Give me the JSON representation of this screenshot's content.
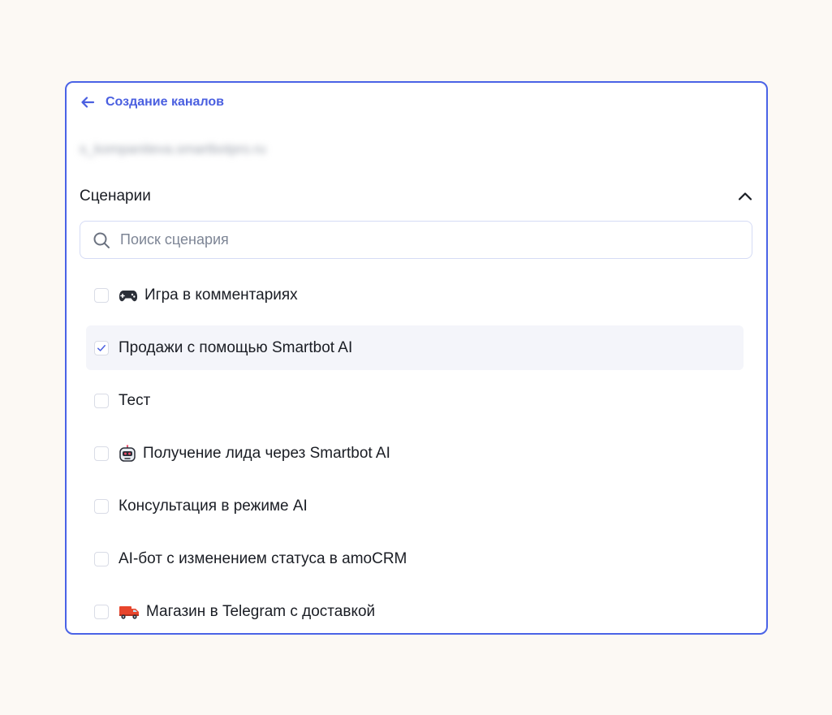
{
  "header": {
    "back_label": "Создание каналов",
    "account_email": "s_kompaniteva.smartbotpro.ru"
  },
  "section": {
    "title": "Сценарии",
    "expanded": true
  },
  "search": {
    "value": "",
    "placeholder": "Поиск сценария"
  },
  "scenarios": [
    {
      "label": "Игра в комментариях",
      "emoji": "🎮",
      "checked": false
    },
    {
      "label": "Продажи с помощью Smartbot AI",
      "emoji": "",
      "checked": true
    },
    {
      "label": "Тест",
      "emoji": "",
      "checked": false
    },
    {
      "label": "Получение лида через Smartbot AI",
      "emoji": "🤖",
      "checked": false
    },
    {
      "label": "Консультация в режиме AI",
      "emoji": "",
      "checked": false
    },
    {
      "label": "AI-бот с изменением статуса в amoCRM",
      "emoji": "",
      "checked": false
    },
    {
      "label": "Магазин в Telegram с доставкой",
      "emoji": "🚚",
      "checked": false
    }
  ],
  "colors": {
    "accent": "#4a63e6",
    "page_background": "#fcf9f4",
    "selected_row": "#f4f5fa"
  },
  "icons": {
    "back": "arrow-left-icon",
    "collapse": "chevron-up-icon",
    "search": "search-icon",
    "check": "checkmark-icon"
  }
}
